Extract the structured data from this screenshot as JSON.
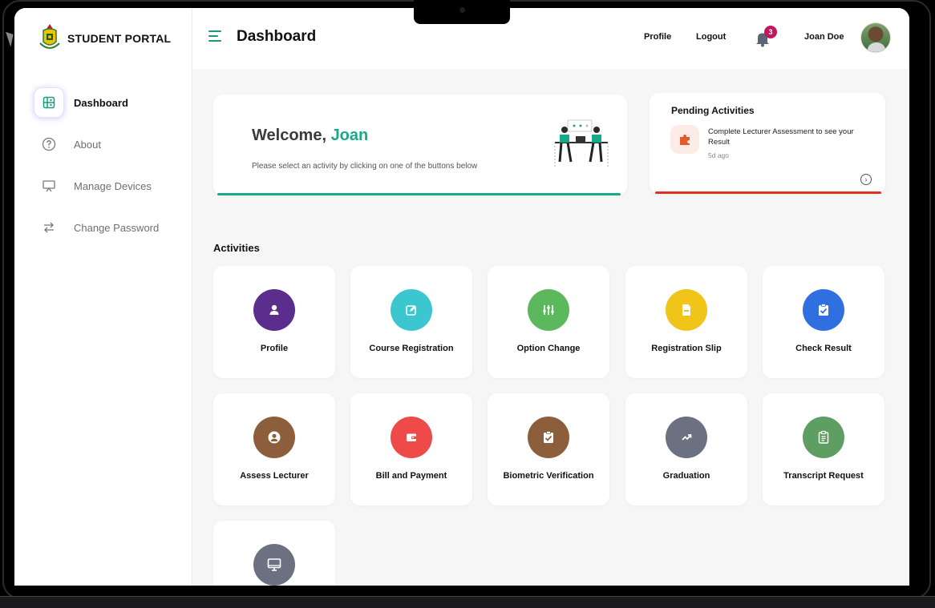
{
  "app": {
    "brand": "STUDENT PORTAL"
  },
  "sidebar": {
    "items": [
      {
        "label": "Dashboard",
        "icon": "dashboard-icon",
        "active": true
      },
      {
        "label": "About",
        "icon": "question-circle-icon"
      },
      {
        "label": "Manage Devices",
        "icon": "monitor-icon"
      },
      {
        "label": "Change Password",
        "icon": "swap-arrows-icon"
      }
    ]
  },
  "header": {
    "title": "Dashboard",
    "profile_link": "Profile",
    "logout_link": "Logout",
    "notification_count": "3",
    "user_name": "Joan Doe"
  },
  "welcome": {
    "greeting": "Welcome,",
    "name": "Joan",
    "subtitle": "Please select an activity by clicking on one of the buttons below"
  },
  "pending": {
    "title": "Pending Activities",
    "item_text": "Complete Lecturer Assessment to see your Result",
    "item_time": "5d ago"
  },
  "activities": {
    "title": "Activities",
    "tiles": [
      {
        "label": "Profile",
        "icon": "person-icon",
        "color": "#5b2d8c"
      },
      {
        "label": "Course Registration",
        "icon": "edit-icon",
        "color": "#3cc6d0"
      },
      {
        "label": "Option Change",
        "icon": "sliders-icon",
        "color": "#5cb85c"
      },
      {
        "label": "Registration Slip",
        "icon": "document-icon",
        "color": "#f0c419"
      },
      {
        "label": "Check Result",
        "icon": "clipboard-check-icon",
        "color": "#2f6fe0"
      },
      {
        "label": "Assess Lecturer",
        "icon": "user-circle-icon",
        "color": "#8c5e3c"
      },
      {
        "label": "Bill and Payment",
        "icon": "wallet-icon",
        "color": "#ef4a4a"
      },
      {
        "label": "Biometric Verification",
        "icon": "fingerprint-check-icon",
        "color": "#8c5e3c"
      },
      {
        "label": "Graduation",
        "icon": "trend-up-icon",
        "color": "#6b7180"
      },
      {
        "label": "Transcript Request",
        "icon": "clipboard-list-icon",
        "color": "#5e9e62"
      },
      {
        "label": "",
        "icon": "desktop-icon",
        "color": "#6b7180"
      }
    ]
  }
}
